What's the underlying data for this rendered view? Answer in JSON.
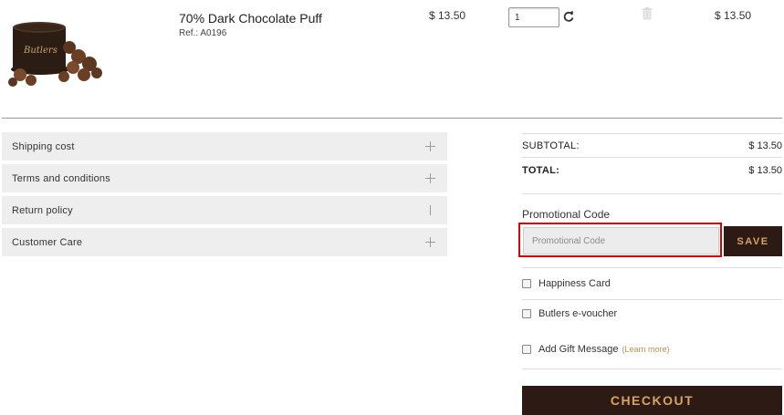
{
  "cart": {
    "item": {
      "name": "70% Dark Chocolate Puff",
      "ref": "Ref.: A0196",
      "unit_price": "$ 13.50",
      "quantity": "1",
      "line_total": "$ 13.50",
      "image_brand": "Butlers"
    }
  },
  "info_accordion": [
    {
      "label": "Shipping cost",
      "state": "collapsed"
    },
    {
      "label": "Terms and conditions",
      "state": "collapsed"
    },
    {
      "label": "Return policy",
      "state": "partial"
    },
    {
      "label": "Customer Care",
      "state": "collapsed"
    }
  ],
  "summary": {
    "subtotal_label": "SUBTOTAL:",
    "subtotal_value": "$ 13.50",
    "total_label": "TOTAL:",
    "total_value": "$ 13.50"
  },
  "promo": {
    "title": "Promotional Code",
    "placeholder": "Promotional Code",
    "save_label": "SAVE"
  },
  "options": {
    "happiness_card": "Happiness Card",
    "evoucher": "Butlers e-voucher",
    "gift_message": "Add Gift Message",
    "learn_more": "(Learn more)"
  },
  "checkout_label": "CHECKOUT",
  "colors": {
    "brand_dark": "#2e1a14",
    "brand_gold": "#d6a461",
    "highlight_red": "#e00000"
  }
}
